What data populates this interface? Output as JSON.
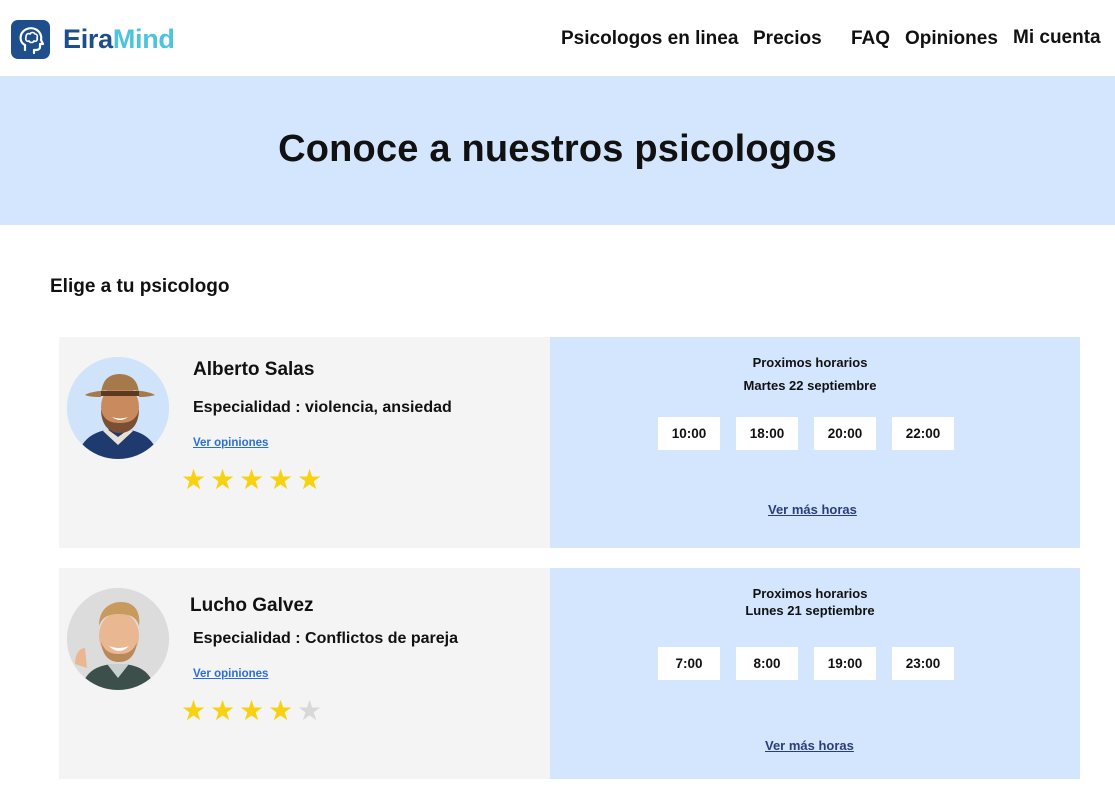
{
  "brand": {
    "part1": "Eira",
    "part2": "Mind",
    "icon": "brain-head-icon"
  },
  "nav": {
    "item1": "Psicologos en linea",
    "item2": "Precios",
    "item3": "FAQ",
    "item4": "Opiniones",
    "item5": "Mi cuenta"
  },
  "hero": {
    "title": "Conoce a nuestros psicologos"
  },
  "section": {
    "title": "Elige a tu psicologo"
  },
  "psychologists": [
    {
      "name": "Alberto Salas",
      "specialty": "Especialidad : violencia, ansiedad",
      "opinions_label": "Ver opiniones",
      "rating": 5,
      "rating_max": 5,
      "schedule_title": "Proximos horarios",
      "schedule_date": "Martes 22 septiembre",
      "slots": [
        "10:00",
        "18:00",
        "20:00",
        "22:00"
      ],
      "more_label": "Ver más horas"
    },
    {
      "name": "Lucho Galvez",
      "specialty": "Especialidad : Conflictos de pareja",
      "opinions_label": "Ver opiniones",
      "rating": 4,
      "rating_max": 5,
      "schedule_title": "Proximos horarios",
      "schedule_date": "Lunes 21 septiembre",
      "slots": [
        "7:00",
        "8:00",
        "19:00",
        "23:00"
      ],
      "more_label": "Ver más horas"
    }
  ],
  "colors": {
    "brand_dark": "#1e4f8c",
    "brand_light": "#4ec3dd",
    "panel_blue": "#d4e6fd",
    "card_gray": "#f4f4f4",
    "star": "#f8d210",
    "star_off": "#d8d8d8",
    "link": "#2b6fd6"
  }
}
